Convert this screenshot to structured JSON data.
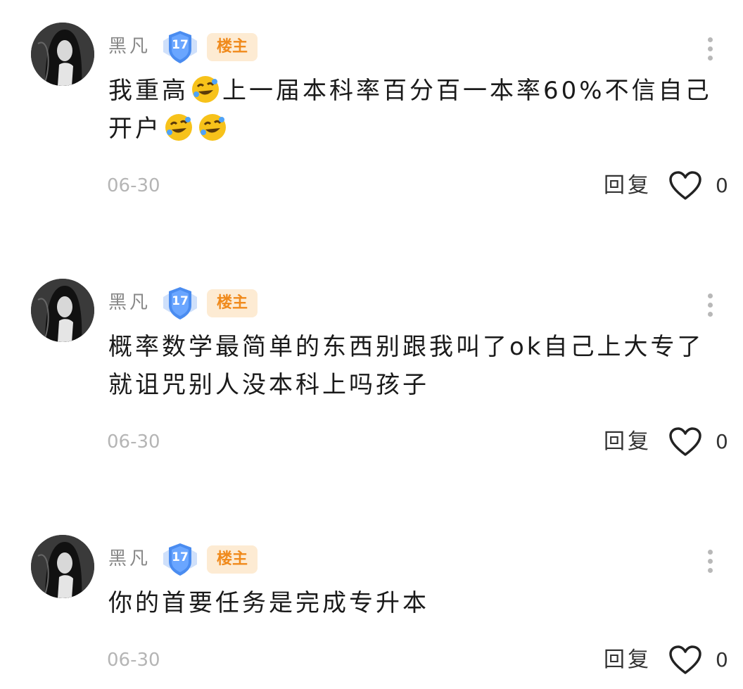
{
  "comments": [
    {
      "author": "黑凡",
      "level": "17",
      "owner_badge": "楼主",
      "text_parts": [
        "我重高",
        "上一届本科率百分百一本率60%不信自己开户"
      ],
      "emoji_name": "rolling-on-floor-laughing",
      "date": "06-30",
      "reply_label": "回复",
      "likes": "0"
    },
    {
      "author": "黑凡",
      "level": "17",
      "owner_badge": "楼主",
      "text": "概率数学最简单的东西别跟我叫了ok自己上大专了就诅咒别人没本科上吗孩子",
      "date": "06-30",
      "reply_label": "回复",
      "likes": "0"
    },
    {
      "author": "黑凡",
      "level": "17",
      "owner_badge": "楼主",
      "text": "你的首要任务是完成专升本",
      "date": "06-30",
      "reply_label": "回复",
      "likes": "0"
    }
  ],
  "colors": {
    "name": "#888888",
    "owner_badge_bg": "#fdebd3",
    "owner_badge_text": "#f08a1c",
    "level_badge": "#4a8cf0",
    "date": "#b5b5b5"
  },
  "icons": [
    "avatar",
    "level-shield-icon",
    "more-icon",
    "heart-icon",
    "emoji-laughing-icon"
  ]
}
